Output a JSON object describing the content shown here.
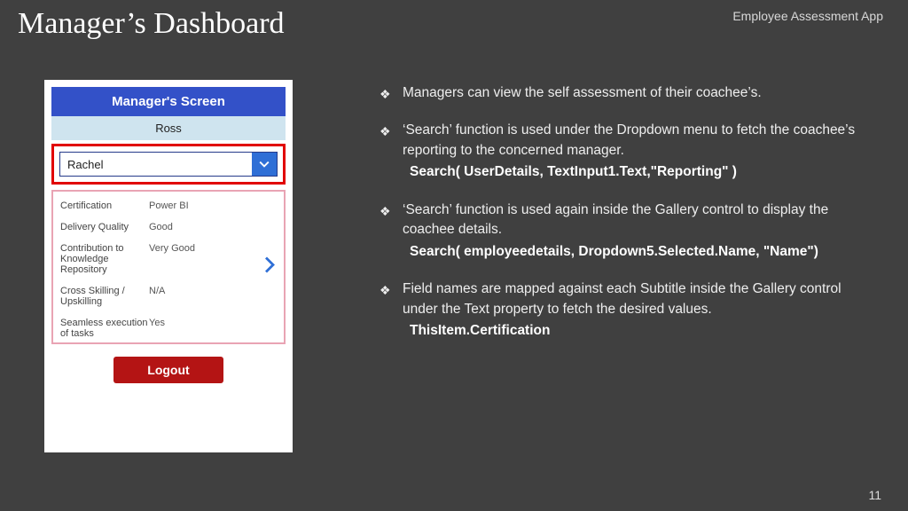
{
  "slide": {
    "title": "Manager’s Dashboard",
    "app_label": "Employee Assessment App",
    "page_number": "11"
  },
  "phone": {
    "header": "Manager's Screen",
    "user": "Ross",
    "dropdown_value": "Rachel",
    "details": [
      {
        "label": "Certification",
        "value": "Power BI"
      },
      {
        "label": "Delivery Quality",
        "value": "Good"
      },
      {
        "label": "Contribution to Knowledge Repository",
        "value": "Very Good"
      },
      {
        "label": "Cross Skilling / Upskilling",
        "value": "N/A"
      },
      {
        "label": "Seamless execution of tasks",
        "value": "Yes"
      }
    ],
    "logout": "Logout"
  },
  "bullets": [
    {
      "text": "Managers can view the self assessment of their coachee’s.",
      "code": ""
    },
    {
      "text": "‘Search’ function is used under the Dropdown menu to fetch the coachee’s reporting to the concerned manager.",
      "code": "Search( UserDetails, TextInput1.Text,\"Reporting\" )"
    },
    {
      "text": "‘Search’ function is used again inside the Gallery control to display the coachee details.",
      "code": "Search( employeedetails, Dropdown5.Selected.Name,  \"Name\")"
    },
    {
      "text": "Field names are mapped against each Subtitle inside the Gallery control under the Text property to fetch the desired values.",
      "code": "ThisItem.Certification"
    }
  ]
}
